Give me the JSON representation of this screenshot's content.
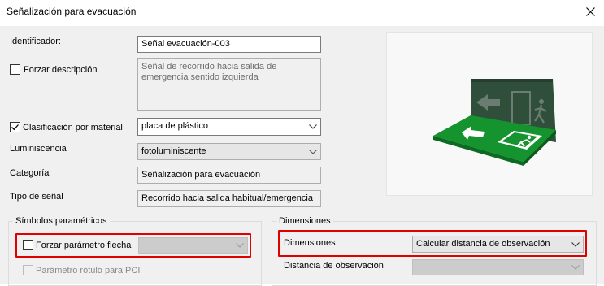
{
  "window": {
    "title": "Señalización para evacuación"
  },
  "form": {
    "identificador": {
      "label": "Identificador:",
      "value": "Señal evacuación-003"
    },
    "forzar_descripcion": {
      "label": "Forzar descripción",
      "checked": false,
      "line1": "Señal de recorrido hacia salida de",
      "line2": "emergencia sentido izquierda"
    },
    "clasificacion": {
      "label": "Clasificación por material",
      "checked": true,
      "value": "placa de plástico"
    },
    "luminiscencia": {
      "label": "Luminiscencia",
      "value": "fotoluminiscente"
    },
    "categoria": {
      "label": "Categoría",
      "value": "Señalización para evacuación"
    },
    "tipo_senal": {
      "label": "Tipo de señal",
      "value": "Recorrido hacia salida habitual/emergencia"
    }
  },
  "simbolos": {
    "title": "Símbolos paramétricos",
    "forzar_flecha": {
      "label": "Forzar parámetro flecha",
      "checked": false,
      "value": ""
    },
    "rotulo_pci": {
      "label": "Parámetro rótulo para PCI",
      "checked": false
    }
  },
  "dimensiones": {
    "title": "Dimensiones",
    "dimensiones_field": {
      "label": "Dimensiones",
      "value": "Calcular distancia de observación"
    },
    "distancia": {
      "label": "Distancia de observación",
      "value": ""
    }
  },
  "colors": {
    "highlight": "#e00000",
    "sign_green": "#0f8f2f",
    "sign_dark": "#2f4f3a"
  },
  "icons": [
    "close-icon",
    "chevron-down-icon",
    "checkmark-icon",
    "exit-sign-preview"
  ]
}
